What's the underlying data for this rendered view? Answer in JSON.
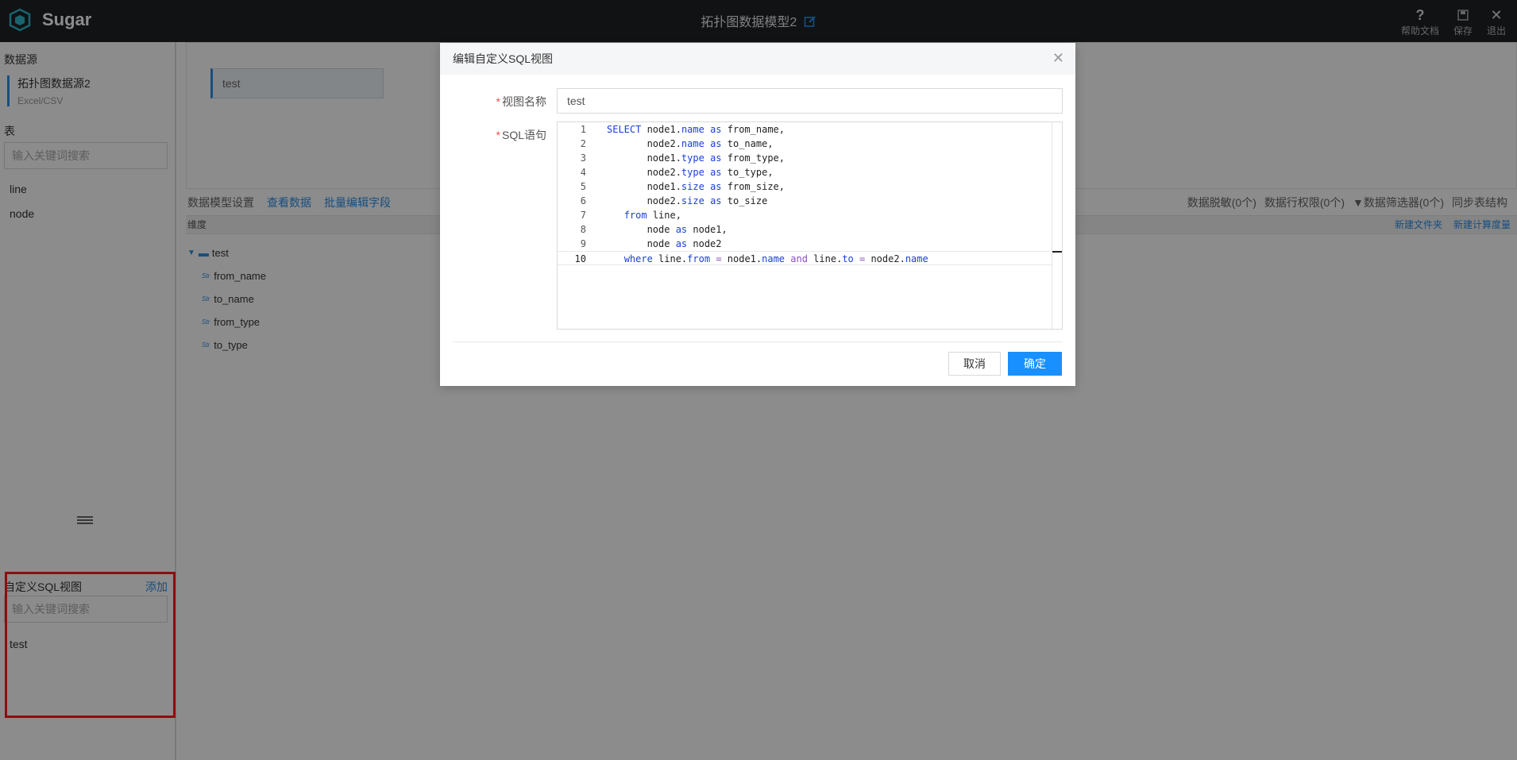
{
  "app": {
    "brand": "Sugar",
    "title": "拓扑图数据模型2"
  },
  "top_actions": [
    {
      "label": "帮助文档",
      "icon": "question-icon"
    },
    {
      "label": "保存",
      "icon": "save-icon"
    },
    {
      "label": "退出",
      "icon": "close-icon"
    }
  ],
  "left": {
    "datasource_title": "数据源",
    "datasource": {
      "name": "拓扑图数据源2",
      "type": "Excel/CSV"
    },
    "table_title": "表",
    "table_search_placeholder": "输入关键词搜索",
    "tables": [
      "line",
      "node"
    ],
    "sqlview_title": "自定义SQL视图",
    "sqlview_add": "添加",
    "sqlview_search_placeholder": "输入关键词搜索",
    "sqlviews": [
      "test"
    ]
  },
  "main": {
    "model_name": "test",
    "tabs": [
      "数据模型设置",
      "查看数据",
      "批量编辑字段"
    ],
    "right_actions": [
      "数据脱敏(0个)",
      "数据行权限(0个)",
      "数据筛选器(0个)",
      "同步表结构"
    ],
    "dim_header": "维度",
    "dim_actions": [
      "新建文件夹",
      "新建计算度量"
    ],
    "tree_root": "test",
    "fields": [
      "from_name",
      "to_name",
      "from_type",
      "to_type"
    ],
    "field_type": "Str"
  },
  "modal": {
    "title": "编辑自定义SQL视图",
    "name_label": "视图名称",
    "name_value": "test",
    "sql_label": "SQL语句",
    "sql_lines": [
      "SELECT node1.name as from_name,",
      "       node2.name as to_name,",
      "       node1.type as from_type,",
      "       node2.type as to_type,",
      "       node1.size as from_size,",
      "       node2.size as to_size",
      "   from line,",
      "       node as node1,",
      "       node as node2",
      "   where line.from = node1.name and line.to = node2.name"
    ],
    "active_line": 10,
    "cancel_label": "取消",
    "ok_label": "确定"
  },
  "colors": {
    "accent": "#1890ff",
    "link": "#2b8ee8",
    "highlight": "#ff1a1a",
    "topbar": "#1e2126"
  }
}
